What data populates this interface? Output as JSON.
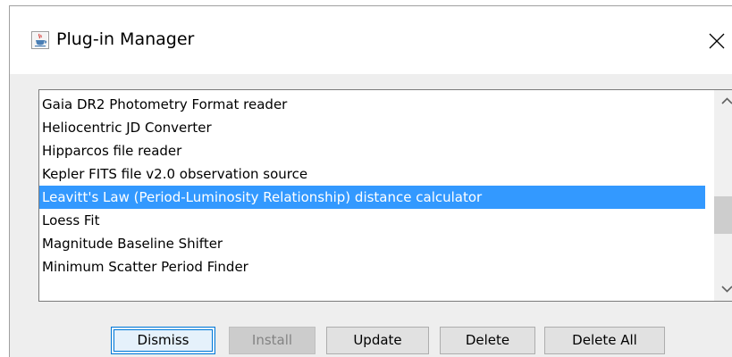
{
  "window": {
    "title": "Plug-in Manager"
  },
  "icons": {
    "app": "java-app-icon",
    "close": "close-icon",
    "scroll_up": "chevron-up-icon",
    "scroll_down": "chevron-down-icon"
  },
  "plugins": {
    "items": [
      "Gaia DR2 Photometry Format reader",
      "Heliocentric JD Converter",
      "Hipparcos file reader",
      "Kepler FITS file v2.0 observation source",
      "Leavitt's Law (Period-Luminosity Relationship) distance calculator",
      "Loess Fit",
      "Magnitude Baseline Shifter",
      "Minimum Scatter Period Finder"
    ],
    "selected_index": 4
  },
  "buttons": {
    "dismiss": "Dismiss",
    "install": "Install",
    "update": "Update",
    "delete": "Delete",
    "delete_all": "Delete All"
  },
  "colors": {
    "selection": "#3399ff",
    "default_button_border": "#0078d7",
    "dialog_background": "#eeeeee"
  }
}
